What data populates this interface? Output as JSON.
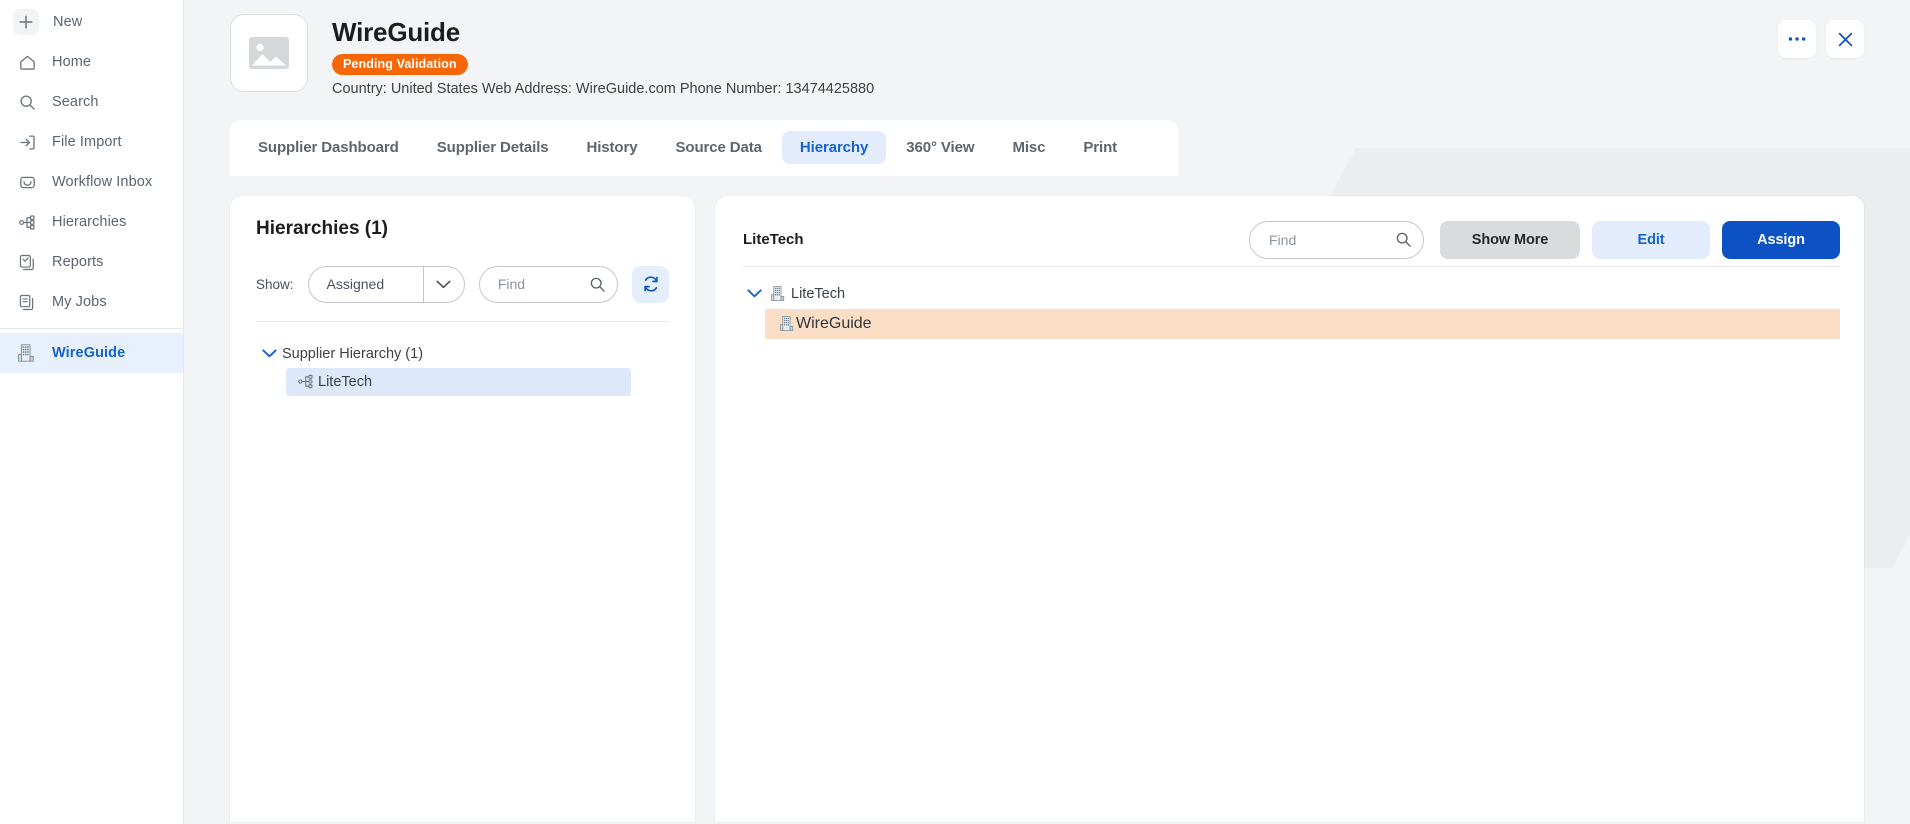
{
  "sidebar": {
    "items": [
      {
        "label": "New",
        "icon": "plus-icon",
        "name": "new"
      },
      {
        "label": "Home",
        "icon": "home-icon",
        "name": "home"
      },
      {
        "label": "Search",
        "icon": "search-icon",
        "name": "search"
      },
      {
        "label": "File Import",
        "icon": "file-import-icon",
        "name": "file-import"
      },
      {
        "label": "Workflow Inbox",
        "icon": "inbox-icon",
        "name": "workflow-inbox"
      },
      {
        "label": "Hierarchies",
        "icon": "hierarchy-icon",
        "name": "hierarchies"
      },
      {
        "label": "Reports",
        "icon": "clipboard-check-icon",
        "name": "reports"
      },
      {
        "label": "My Jobs",
        "icon": "documents-icon",
        "name": "my-jobs"
      }
    ],
    "active_item": {
      "label": "WireGuide",
      "icon": "building-icon",
      "name": "wireguide"
    }
  },
  "header": {
    "thumbnail_icon": "image-placeholder-icon",
    "title": "WireGuide",
    "badge": "Pending Validation",
    "meta": "Country: United States Web Address: WireGuide.com Phone Number: 13474425880",
    "more_icon": "ellipsis-icon",
    "close_icon": "close-icon"
  },
  "tabs": [
    {
      "label": "Supplier Dashboard",
      "active": false
    },
    {
      "label": "Supplier Details",
      "active": false
    },
    {
      "label": "History",
      "active": false
    },
    {
      "label": "Source Data",
      "active": false
    },
    {
      "label": "Hierarchy",
      "active": true
    },
    {
      "label": "360° View",
      "active": false
    },
    {
      "label": "Misc",
      "active": false
    },
    {
      "label": "Print",
      "active": false
    }
  ],
  "left_panel": {
    "title": "Hierarchies (1)",
    "show_label": "Show:",
    "show_value": "Assigned",
    "show_options": [
      "Assigned"
    ],
    "dropdown_icon": "chevron-down-icon",
    "find_placeholder": "Find",
    "find_value": "",
    "find_icon": "search-icon",
    "refresh_icon": "refresh-icon",
    "tree": {
      "root_label": "Supplier Hierarchy (1)",
      "root_caret": "chevron-down-icon",
      "child_label": "LiteTech",
      "child_icon": "org-node-icon",
      "child_selected": true
    }
  },
  "right_panel": {
    "title": "LiteTech",
    "find_placeholder": "Find",
    "find_value": "",
    "find_icon": "search-icon",
    "show_more_label": "Show More",
    "edit_label": "Edit",
    "assign_label": "Assign",
    "tree": {
      "root_label": "LiteTech",
      "root_caret": "chevron-down-icon",
      "root_icon": "building-icon",
      "child_label": "WireGuide",
      "child_icon": "building-icon",
      "child_highlighted": true
    }
  },
  "colors": {
    "accent_blue": "#1763cc",
    "primary_button": "#0d52c4",
    "badge_orange": "#f76707",
    "selected_row_blue": "#dde9fa",
    "highlight_row_orange": "#fbdec6",
    "page_background": "#f3f4f5"
  }
}
